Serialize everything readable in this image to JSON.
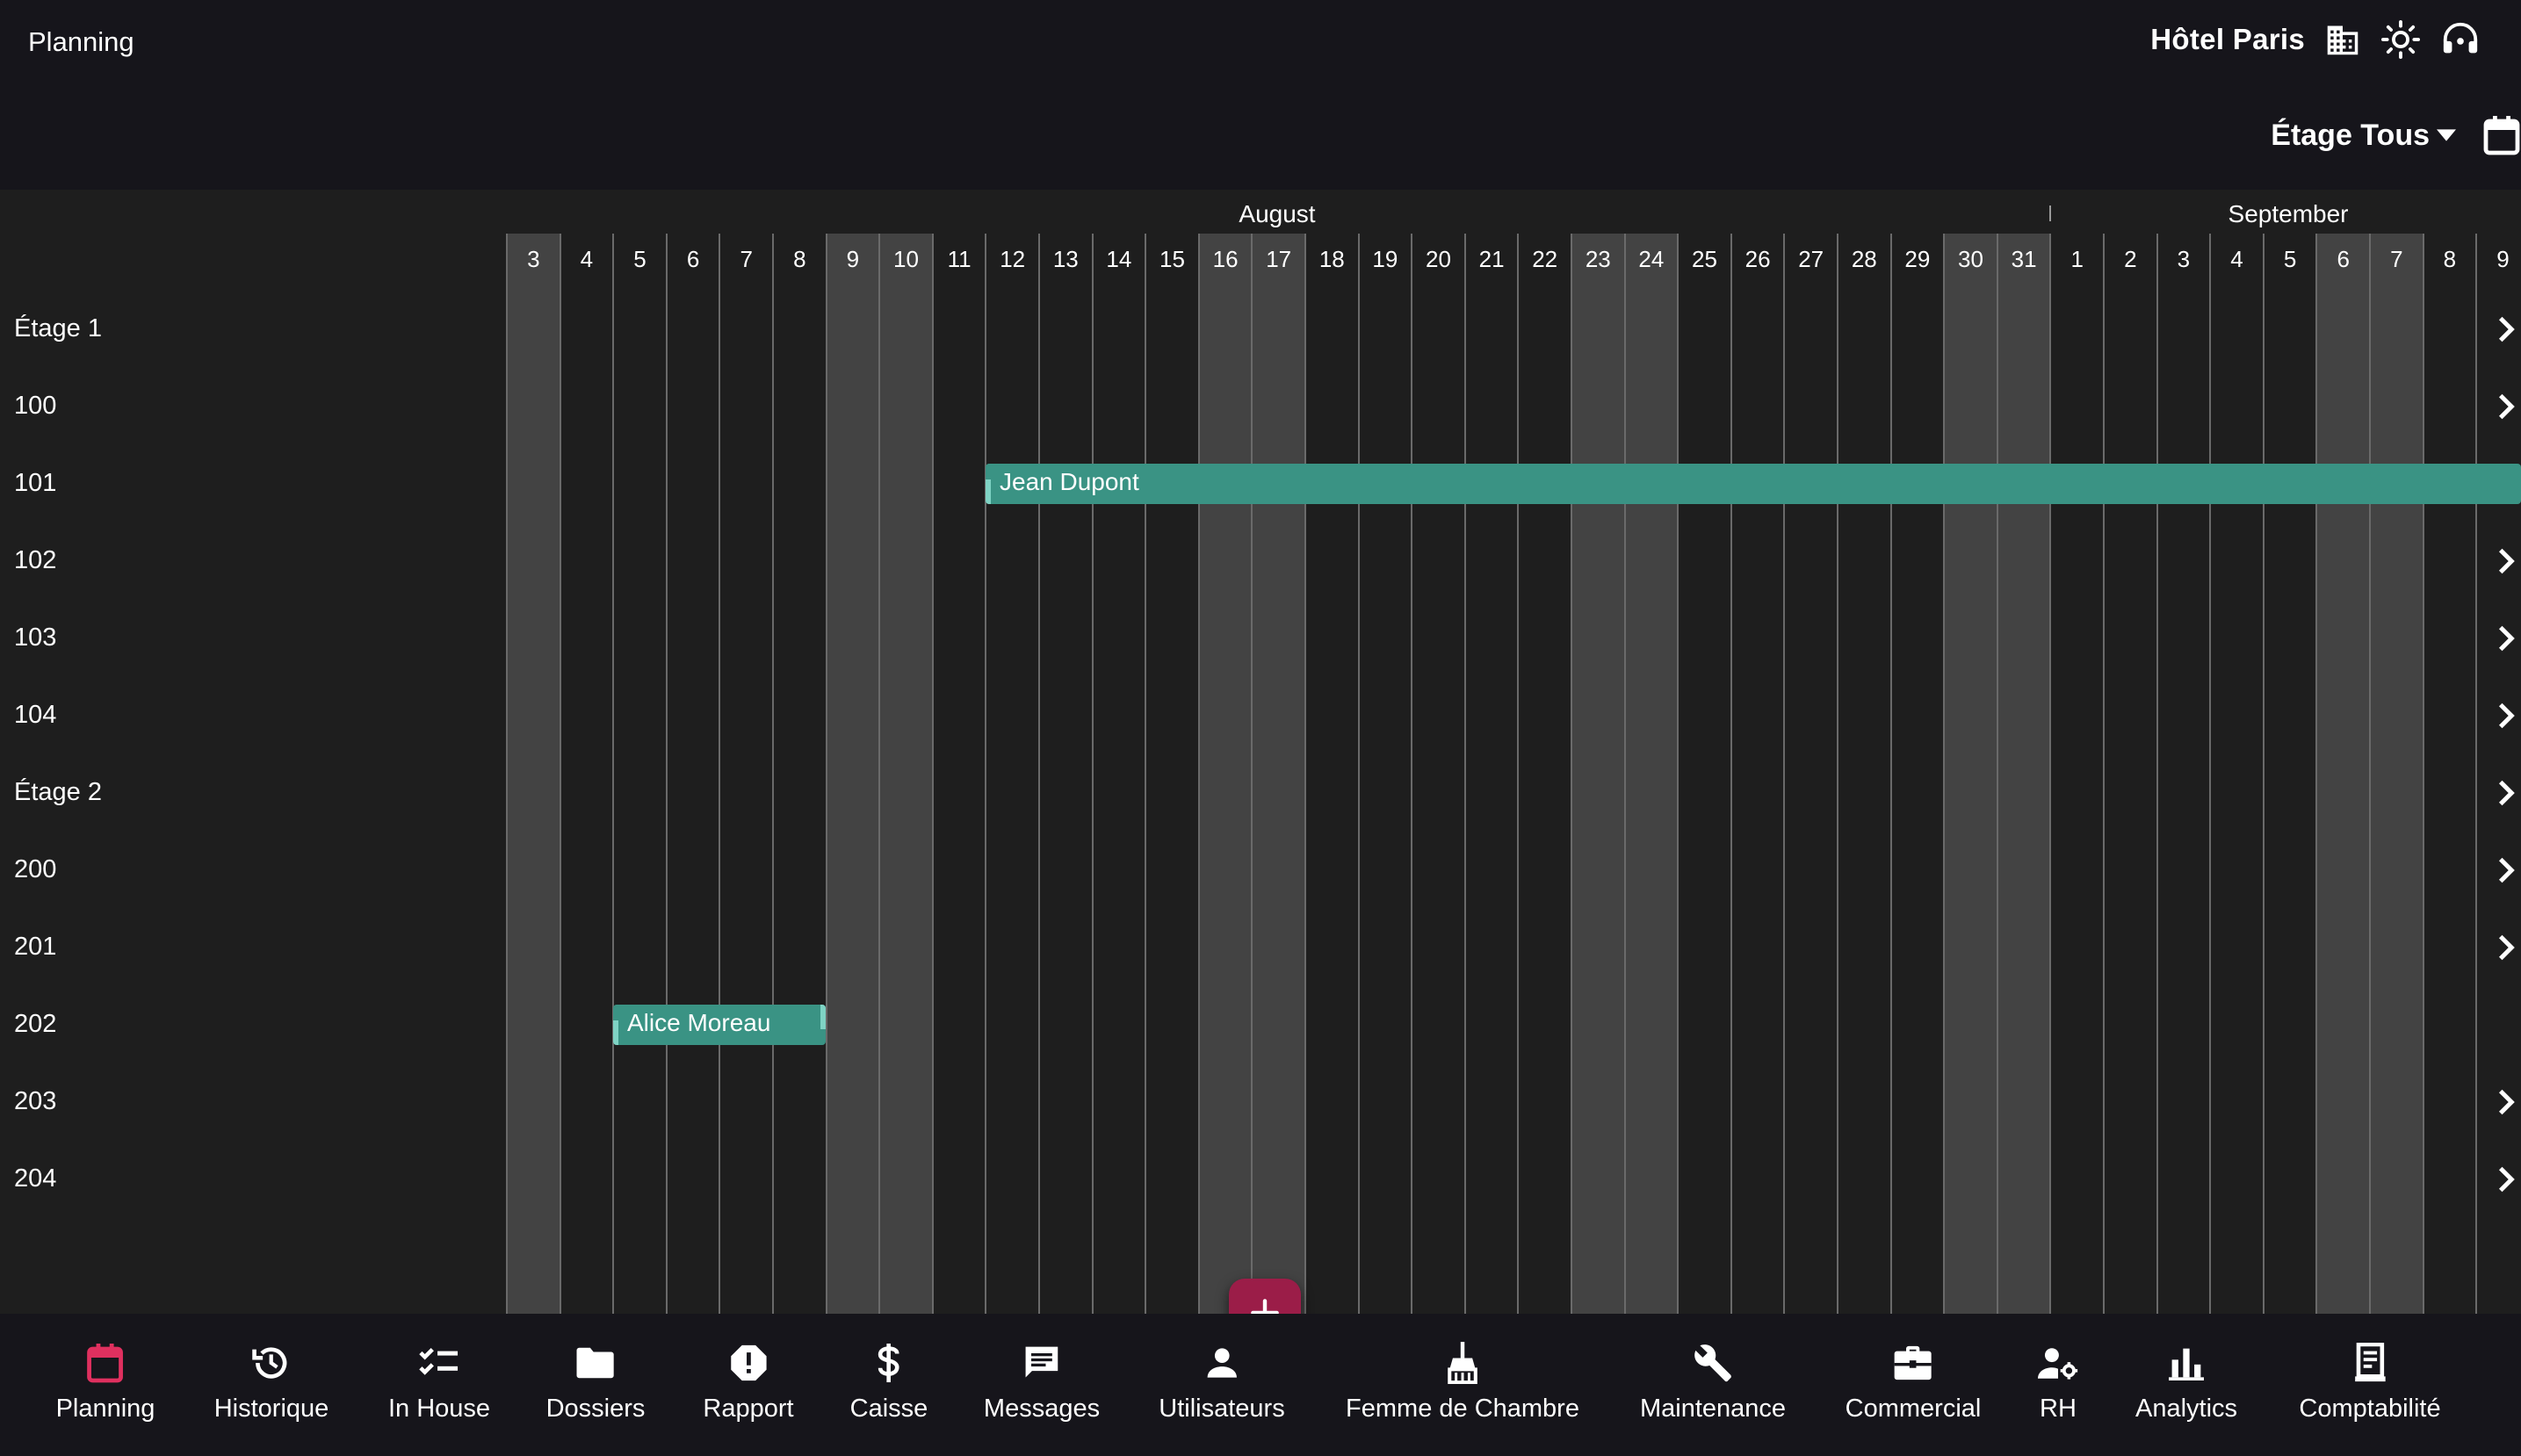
{
  "header": {
    "title": "Planning",
    "hotel_name": "Hôtel Paris",
    "floor_filter_label": "Étage Tous"
  },
  "calendar": {
    "months": [
      "August",
      "September"
    ],
    "days": [
      "3",
      "4",
      "5",
      "6",
      "7",
      "8",
      "9",
      "10",
      "11",
      "12",
      "13",
      "14",
      "15",
      "16",
      "17",
      "18",
      "19",
      "20",
      "21",
      "22",
      "23",
      "24",
      "25",
      "26",
      "27",
      "28",
      "29",
      "30",
      "31",
      "1",
      "2",
      "3",
      "4",
      "5",
      "6",
      "7",
      "8",
      "9"
    ],
    "weekend_days": [
      "3 Aug",
      "9 Aug",
      "10 Aug",
      "16 Aug",
      "17 Aug",
      "23 Aug",
      "24 Aug",
      "30 Aug",
      "31 Aug",
      "6 Sep",
      "7 Sep"
    ]
  },
  "rows": [
    "Étage 1",
    "100",
    "101",
    "102",
    "103",
    "104",
    "Étage 2",
    "200",
    "201",
    "202",
    "203",
    "204"
  ],
  "bookings": [
    {
      "guest": "Jean Dupont",
      "room": "101",
      "start": "12 Aug",
      "end": "beyond 9 Sep"
    },
    {
      "guest": "Alice Moreau",
      "room": "202",
      "start": "5 Aug",
      "end": "8 Aug"
    }
  ],
  "fab": {
    "icon": "plus-icon"
  },
  "nav": [
    {
      "label": "Planning",
      "icon": "calendar-icon",
      "active": true
    },
    {
      "label": "Historique",
      "icon": "history-icon"
    },
    {
      "label": "In House",
      "icon": "checklist-icon"
    },
    {
      "label": "Dossiers",
      "icon": "folder-icon"
    },
    {
      "label": "Rapport",
      "icon": "report-icon"
    },
    {
      "label": "Caisse",
      "icon": "dollar-icon"
    },
    {
      "label": "Messages",
      "icon": "message-icon"
    },
    {
      "label": "Utilisateurs",
      "icon": "user-icon"
    },
    {
      "label": "Femme de Chambre",
      "icon": "broom-icon"
    },
    {
      "label": "Maintenance",
      "icon": "wrench-icon"
    },
    {
      "label": "Commercial",
      "icon": "briefcase-icon"
    },
    {
      "label": "RH",
      "icon": "user-settings-icon"
    },
    {
      "label": "Analytics",
      "icon": "bar-chart-icon"
    },
    {
      "label": "Comptabilité",
      "icon": "receipt-icon"
    }
  ],
  "colors": {
    "accent": "#e0305f",
    "booking": "#3a9384",
    "fab": "#9b1d48",
    "weekend": "#434343",
    "bar_bg": "#16151b"
  }
}
